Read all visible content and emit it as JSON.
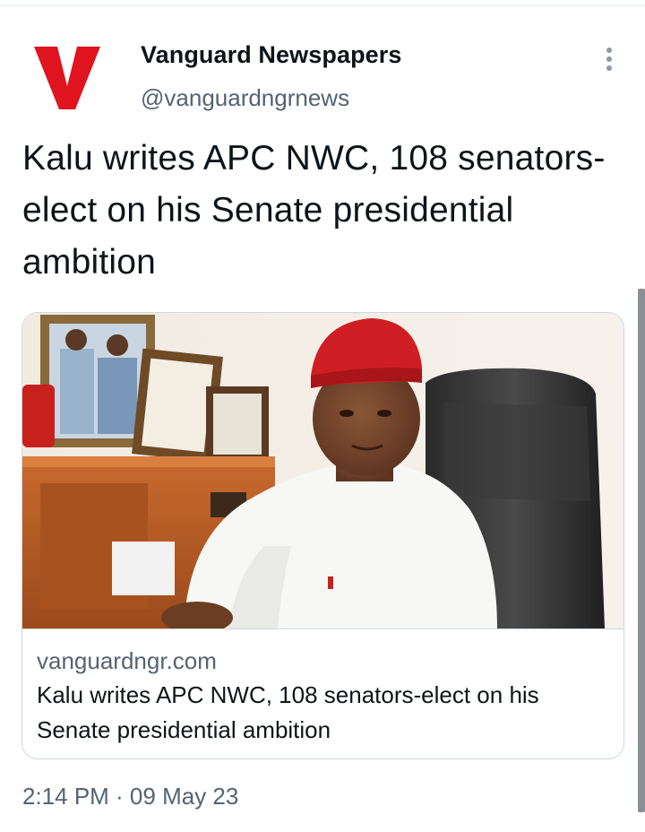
{
  "tweet": {
    "account": {
      "avatar_icon": "vanguard-v-logo-icon",
      "avatar_color": "#e0141e",
      "display_name": "Vanguard Newspapers",
      "handle": "@vanguardngrnews"
    },
    "more_icon": "more-vertical-icon",
    "text": "Kalu writes APC NWC, 108 senators-elect on his Senate presidential ambition",
    "card": {
      "domain": "vanguardngr.com",
      "title": "Kalu writes APC NWC, 108 senators-elect on his Senate presidential ambition"
    },
    "timestamp": "2:14 PM · 09 May 23"
  },
  "colors": {
    "text_primary": "#0f1419",
    "text_secondary": "#536471",
    "border": "#cfd9de"
  }
}
